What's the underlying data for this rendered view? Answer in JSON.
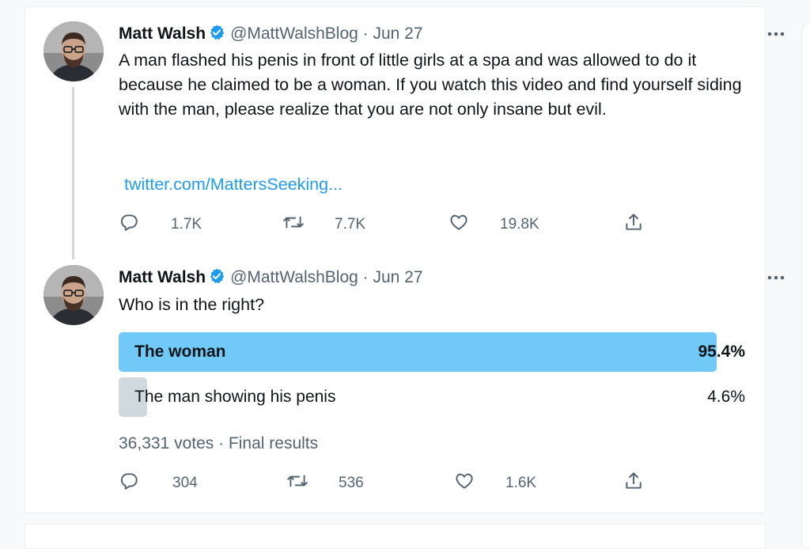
{
  "tweets": [
    {
      "author_name": "Matt Walsh",
      "handle_date": "@MattWalshBlog · Jun 27",
      "text": "A man flashed his penis in front of little girls at a spa and was allowed to do it because he claimed to be a woman. If you watch this video and find yourself siding with the man, please realize that you are not only insane but evil.",
      "link": "twitter.com/MattersSeeking...",
      "replies": "1.7K",
      "retweets": "7.7K",
      "likes": "19.8K"
    },
    {
      "author_name": "Matt Walsh",
      "handle_date": "@MattWalshBlog · Jun 27",
      "text": "Who is in the right?",
      "poll": {
        "options": [
          {
            "label": "The woman",
            "percent_text": "95.4%",
            "percent": 95.4,
            "winner": true
          },
          {
            "label": "The man showing his penis",
            "percent_text": "4.6%",
            "percent": 4.6,
            "winner": false
          }
        ],
        "summary": "36,331 votes · Final results"
      },
      "replies": "304",
      "retweets": "536",
      "likes": "1.6K"
    }
  ],
  "icons": {
    "verified": "verified-badge-icon",
    "more": "more-icon",
    "reply": "reply-icon",
    "retweet": "retweet-icon",
    "like": "like-icon",
    "share": "share-icon"
  },
  "colors": {
    "accent": "#1d9bf0",
    "poll_winner": "#71c9f8",
    "poll_other": "#cfd9de",
    "secondary_text": "#536471"
  }
}
